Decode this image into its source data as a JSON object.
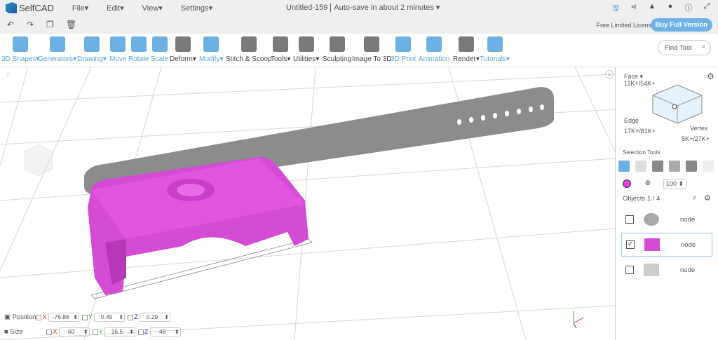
{
  "app": {
    "name": "SelfCAD",
    "menus": [
      "File",
      "Edit",
      "View",
      "Settings"
    ],
    "doc_title": "Untitled-159",
    "autosave": "Auto-save in about 2 minutes"
  },
  "header_icons": [
    "save-icon",
    "share-icon",
    "bell-icon",
    "user-icon",
    "info-icon",
    "fullscreen-icon"
  ],
  "license": {
    "text": "Free Limited License",
    "buy": "Buy Full Version"
  },
  "toolbar": [
    {
      "label": "3D Shapes",
      "dd": true,
      "style": "blue",
      "icon": "cube-icon"
    },
    {
      "label": "Generators",
      "dd": true,
      "style": "blue",
      "icon": "generator-icon"
    },
    {
      "label": "Drawing",
      "dd": true,
      "style": "blue",
      "icon": "drawing-icon"
    },
    {
      "label": "Move",
      "dd": false,
      "style": "blue",
      "icon": "move-icon"
    },
    {
      "label": "Rotate",
      "dd": false,
      "style": "blue",
      "icon": "rotate-icon"
    },
    {
      "label": "Scale",
      "dd": false,
      "style": "blue",
      "icon": "scale-icon"
    },
    {
      "label": "Deform",
      "dd": true,
      "style": "dark",
      "icon": "deform-icon"
    },
    {
      "label": "Modify",
      "dd": true,
      "style": "blue",
      "icon": "modify-icon"
    },
    {
      "label": "Stitch & Scoop",
      "dd": false,
      "style": "dark",
      "icon": "stitch-icon"
    },
    {
      "label": "Tools",
      "dd": true,
      "style": "dark",
      "icon": "tools-icon"
    },
    {
      "label": "Utilities",
      "dd": true,
      "style": "dark",
      "icon": "utilities-icon"
    },
    {
      "label": "Sculpting",
      "dd": false,
      "style": "dark",
      "icon": "sculpting-icon"
    },
    {
      "label": "Image To 3D",
      "dd": false,
      "style": "dark",
      "icon": "image-icon"
    },
    {
      "label": "3D Print",
      "dd": false,
      "style": "blue",
      "icon": "print-icon"
    },
    {
      "label": "Animation",
      "dd": false,
      "style": "blue",
      "icon": "animation-icon"
    },
    {
      "label": "Render",
      "dd": true,
      "style": "dark",
      "icon": "render-icon"
    },
    {
      "label": "Tutorials",
      "dd": true,
      "style": "blue",
      "icon": "tutorials-icon"
    }
  ],
  "find_tool": "Find Tool",
  "panel": {
    "face": "Face",
    "face_count": "11K+/54K+",
    "edge": "Edge",
    "edge_count": "17K+/81K+",
    "vertex": "Vertex",
    "vertex_count": "5K+/27K+",
    "selection_tools": "Selection Tools",
    "color": "#e83ee0",
    "opacity": "100",
    "objects": "Objects 1 / 4",
    "items": [
      {
        "name": "node",
        "checked": false
      },
      {
        "name": "node",
        "checked": true
      },
      {
        "name": "node",
        "checked": false
      }
    ]
  },
  "transform": {
    "position_label": "Position",
    "size_label": "Size",
    "position": {
      "x": "-76.86",
      "y": "0.49",
      "z": "0.29"
    },
    "size": {
      "x": "60",
      "y": "16.5",
      "z": "46"
    },
    "axes": {
      "x": "X",
      "y": "Y",
      "z": "Z"
    }
  }
}
